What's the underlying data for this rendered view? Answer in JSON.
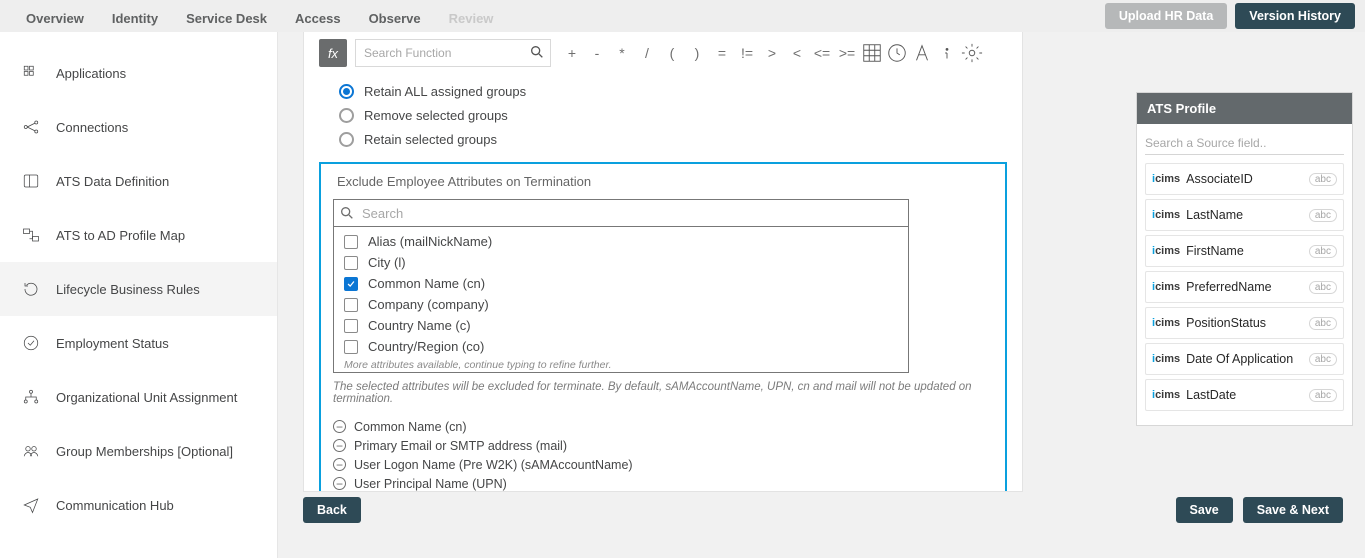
{
  "nav": {
    "tabs": [
      "Overview",
      "Identity",
      "Service Desk",
      "Access",
      "Observe",
      "Review"
    ],
    "upload": "Upload HR Data",
    "version": "Version History"
  },
  "sidebar": {
    "items": [
      {
        "label": "Applications"
      },
      {
        "label": "Connections"
      },
      {
        "label": "ATS Data Definition"
      },
      {
        "label": "ATS to AD Profile Map"
      },
      {
        "label": "Lifecycle Business Rules"
      },
      {
        "label": "Employment Status"
      },
      {
        "label": "Organizational Unit Assignment"
      },
      {
        "label": "Group Memberships [Optional]"
      },
      {
        "label": "Communication Hub"
      }
    ]
  },
  "fx": {
    "placeholder": "Search Function",
    "ops": [
      "+",
      "-",
      "*",
      "/",
      "(",
      ")",
      "=",
      "!=",
      ">",
      "<",
      "<=",
      ">="
    ]
  },
  "radios": {
    "opts": [
      {
        "label": "Retain ALL assigned groups",
        "checked": true
      },
      {
        "label": "Remove selected groups",
        "checked": false
      },
      {
        "label": "Retain selected groups",
        "checked": false
      }
    ]
  },
  "exclude": {
    "title": "Exclude Employee Attributes on Termination",
    "search_ph": "Search",
    "attrs": [
      {
        "label": "Alias (mailNickName)",
        "checked": false
      },
      {
        "label": "City (l)",
        "checked": false
      },
      {
        "label": "Common Name (cn)",
        "checked": true
      },
      {
        "label": "Company (company)",
        "checked": false
      },
      {
        "label": "Country Name (c)",
        "checked": false
      },
      {
        "label": "Country/Region (co)",
        "checked": false
      }
    ],
    "more_note": "More attributes available, continue typing to refine further.",
    "help": "The selected attributes will be excluded for terminate. By default, sAMAccountName, UPN, cn and mail will not be updated on termination.",
    "selected": [
      "Common Name (cn)",
      "Primary Email or SMTP address (mail)",
      "User Logon Name (Pre W2K) (sAMAccountName)",
      "User Principal Name (UPN)"
    ]
  },
  "footer": {
    "back": "Back",
    "save": "Save",
    "savenext": "Save & Next"
  },
  "ats": {
    "title": "ATS Profile",
    "search_ph": "Search a Source field..",
    "fields": [
      {
        "name": "AssociateID",
        "type": "abc"
      },
      {
        "name": "LastName",
        "type": "abc"
      },
      {
        "name": "FirstName",
        "type": "abc"
      },
      {
        "name": "PreferredName",
        "type": "abc"
      },
      {
        "name": "PositionStatus",
        "type": "abc"
      },
      {
        "name": "Date Of Application",
        "type": "abc"
      },
      {
        "name": "LastDate",
        "type": "abc"
      }
    ]
  }
}
